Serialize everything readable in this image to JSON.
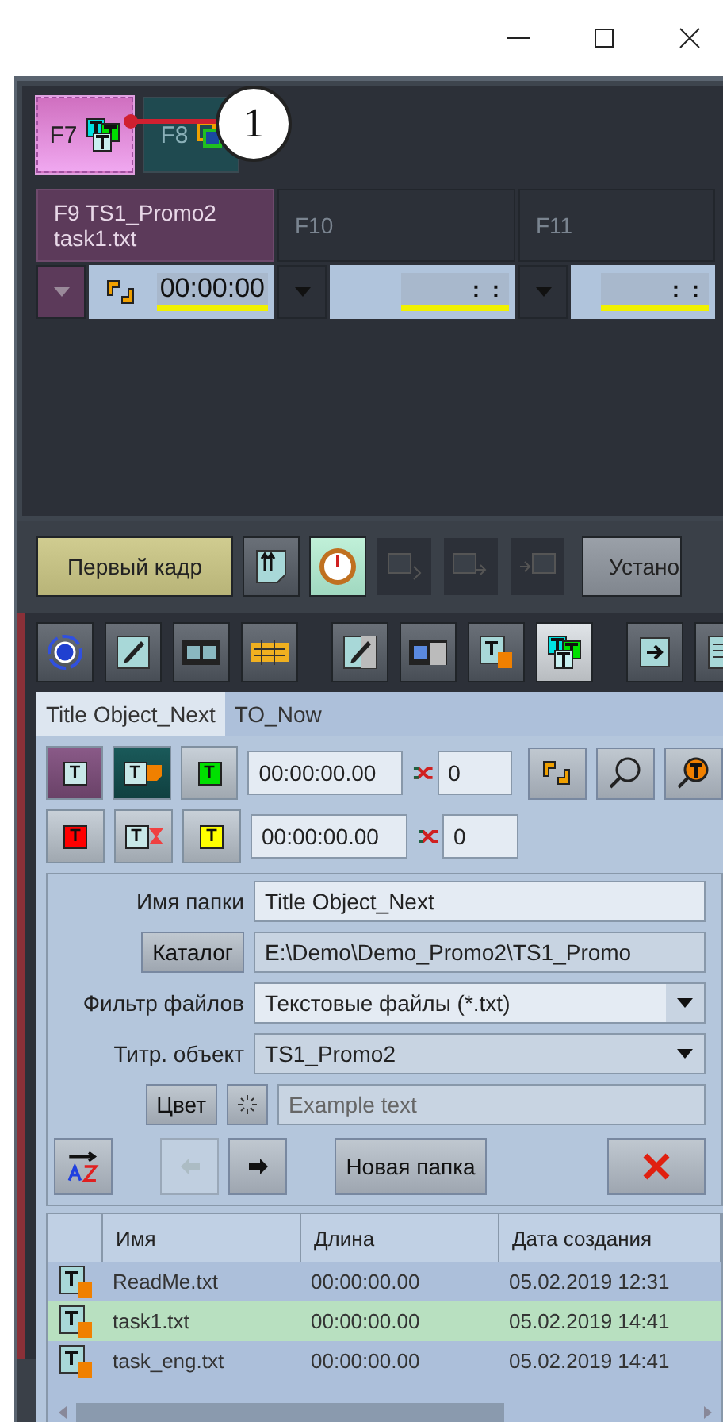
{
  "function_keys": [
    {
      "label": "F7",
      "selected": true
    },
    {
      "label": "F8",
      "selected": false
    }
  ],
  "callout": {
    "number": "1"
  },
  "channels": [
    {
      "title": "F9 TS1_Promo2",
      "subtitle": "task1.txt",
      "time": "00:00:00",
      "selected": true
    },
    {
      "title": "F10",
      "time": ":  :",
      "selected": false
    },
    {
      "title": "F11",
      "time": ":  :",
      "selected": false
    }
  ],
  "toolbar": [
    {
      "kind": "text",
      "label": "Первый кадр",
      "on": true,
      "disabled": false
    },
    {
      "kind": "icon",
      "on": false,
      "disabled": false
    },
    {
      "kind": "icon",
      "on": true,
      "disabled": false
    },
    {
      "kind": "icon",
      "on": false,
      "disabled": true
    },
    {
      "kind": "icon",
      "on": false,
      "disabled": true
    },
    {
      "kind": "icon",
      "on": false,
      "disabled": true
    },
    {
      "kind": "text",
      "label": "Устано",
      "on": false,
      "disabled": false
    }
  ],
  "tool_icons": [
    {
      "selected": false
    },
    {
      "selected": false
    },
    {
      "selected": false
    },
    {
      "selected": false
    },
    {
      "selected": false
    },
    {
      "selected": false
    },
    {
      "selected": false
    },
    {
      "selected": true
    },
    {
      "selected": false
    },
    {
      "selected": false
    }
  ],
  "tabs": [
    {
      "label": "Title Object_Next",
      "selected": true
    },
    {
      "label": "TO_Now",
      "selected": false
    }
  ],
  "title_rows": [
    {
      "buttons": [
        {
          "glyph": "T",
          "kind": "plain",
          "color": "#c8e8e8",
          "on": true
        },
        {
          "glyph": "T",
          "kind": "document",
          "color": "#c8e8e8",
          "on": true
        },
        {
          "glyph": "T",
          "kind": "plain",
          "color": "#00e000",
          "on": false
        }
      ],
      "time": "00:00:00.00",
      "count": "0"
    },
    {
      "buttons": [
        {
          "glyph": "T",
          "kind": "plain",
          "color": "#ff0000",
          "on": false
        },
        {
          "glyph": "T",
          "kind": "timer",
          "color": "#c8e8e8",
          "on": false
        },
        {
          "glyph": "T",
          "kind": "plain",
          "color": "#ffff00",
          "on": false
        }
      ],
      "time": "00:00:00.00",
      "count": "0"
    }
  ],
  "form": [
    {
      "kind": "text",
      "label": "Имя папки",
      "value": "Title Object_Next"
    },
    {
      "kind": "button",
      "label": "Каталог",
      "value": "E:\\Demo\\Demo_Promo2\\TS1_Promo"
    },
    {
      "kind": "select",
      "label": "Фильтр файлов",
      "value": "Текстовые файлы (*.txt)",
      "focused": true
    },
    {
      "kind": "select",
      "label": "Титр. объект",
      "value": "TS1_Promo2",
      "focused": false
    },
    {
      "kind": "color",
      "label": "Цвет",
      "placeholder": "Example text"
    }
  ],
  "actions": [
    {
      "kind": "sort",
      "disabled": false
    },
    {
      "kind": "back",
      "disabled": true
    },
    {
      "kind": "forward",
      "disabled": false
    },
    {
      "kind": "text",
      "label": "Новая папка",
      "disabled": false
    },
    {
      "kind": "delete",
      "disabled": false
    }
  ],
  "table": {
    "columns": [
      "Имя",
      "Длина",
      "Дата создания"
    ],
    "rows": [
      {
        "name": "ReadMe.txt",
        "length": "00:00:00.00",
        "created": "05.02.2019 12:31",
        "selected": false
      },
      {
        "name": "task1.txt",
        "length": "00:00:00.00",
        "created": "05.02.2019 14:41",
        "selected": true
      },
      {
        "name": "task_eng.txt",
        "length": "00:00:00.00",
        "created": "05.02.2019 14:41",
        "selected": false
      }
    ]
  }
}
